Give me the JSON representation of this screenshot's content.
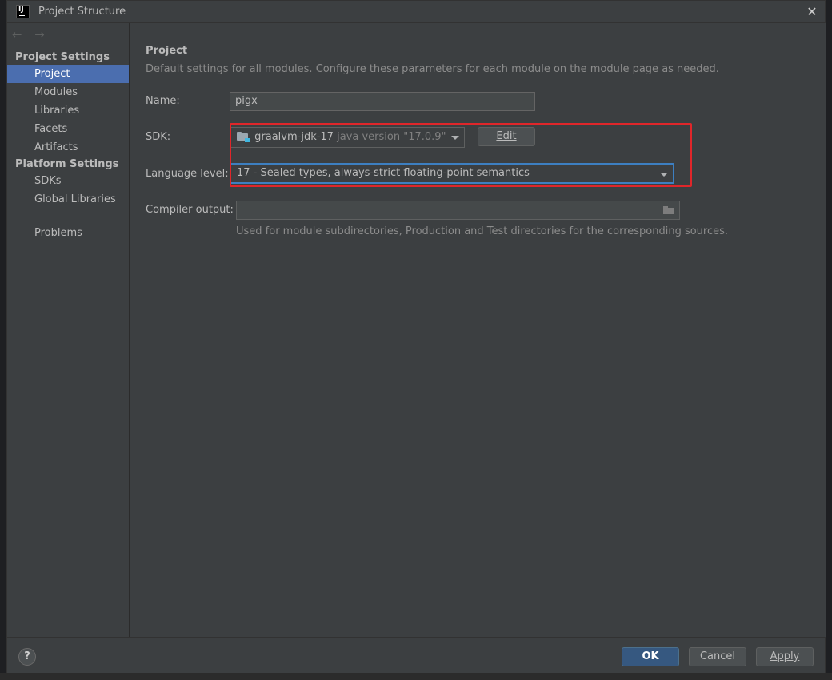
{
  "window": {
    "title": "Project Structure",
    "logo_text": "IJ"
  },
  "sidebar": {
    "sections": [
      {
        "title": "Project Settings",
        "items": [
          "Project",
          "Modules",
          "Libraries",
          "Facets",
          "Artifacts"
        ]
      },
      {
        "title": "Platform Settings",
        "items": [
          "SDKs",
          "Global Libraries"
        ]
      }
    ],
    "extra_items": [
      "Problems"
    ],
    "selected": "Project"
  },
  "main": {
    "title": "Project",
    "description": "Default settings for all modules. Configure these parameters for each module on the module page as needed.",
    "name_label": "Name:",
    "name_value": "pigx",
    "sdk_label": "SDK:",
    "sdk_name": "graalvm-jdk-17",
    "sdk_version": "java version \"17.0.9\"",
    "edit_button": "Edit",
    "language_label": "Language level:",
    "language_value": "17 - Sealed types, always-strict floating-point semantics",
    "compiler_label": "Compiler output:",
    "compiler_value": "",
    "compiler_hint": "Used for module subdirectories, Production and Test directories for the corresponding sources."
  },
  "footer": {
    "help": "?",
    "ok": "OK",
    "cancel": "Cancel",
    "apply": "Apply"
  },
  "colors": {
    "selection": "#4b6eaf",
    "highlight_box": "#e0262a",
    "focus": "#3d7fc1",
    "primary_button": "#365880"
  }
}
